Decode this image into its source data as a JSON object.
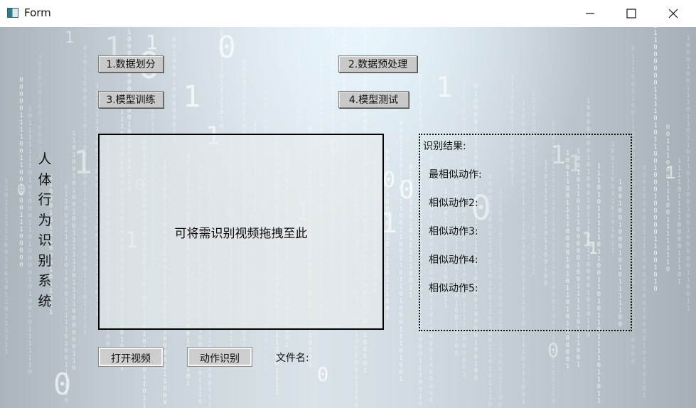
{
  "window": {
    "title": "Form",
    "controls": [
      "minimize-icon",
      "maximize-icon",
      "close-icon"
    ]
  },
  "sidebar": {
    "system_title_chars": [
      "人",
      "体",
      "行",
      "为",
      "识",
      "别",
      "系",
      "统"
    ]
  },
  "toolbar": {
    "data_split": "1.数据划分",
    "data_preprocess": "2.数据预处理",
    "model_train": "3.模型训练",
    "model_test": "4.模型测试"
  },
  "drop_zone": {
    "hint": "可将需识别视频拖拽至此"
  },
  "results": {
    "heading": "识别结果:",
    "rows": [
      "最相似动作:",
      "相似动作2:",
      "相似动作3:",
      "相似动作4:",
      "相似动作5:"
    ]
  },
  "actions": {
    "open_video": "打开视频",
    "recognize": "动作识别",
    "filename_label": "文件名:"
  },
  "colors": {
    "background_tone": "#c6d2d8",
    "button": "#c9c9c9",
    "text": "#111111"
  }
}
